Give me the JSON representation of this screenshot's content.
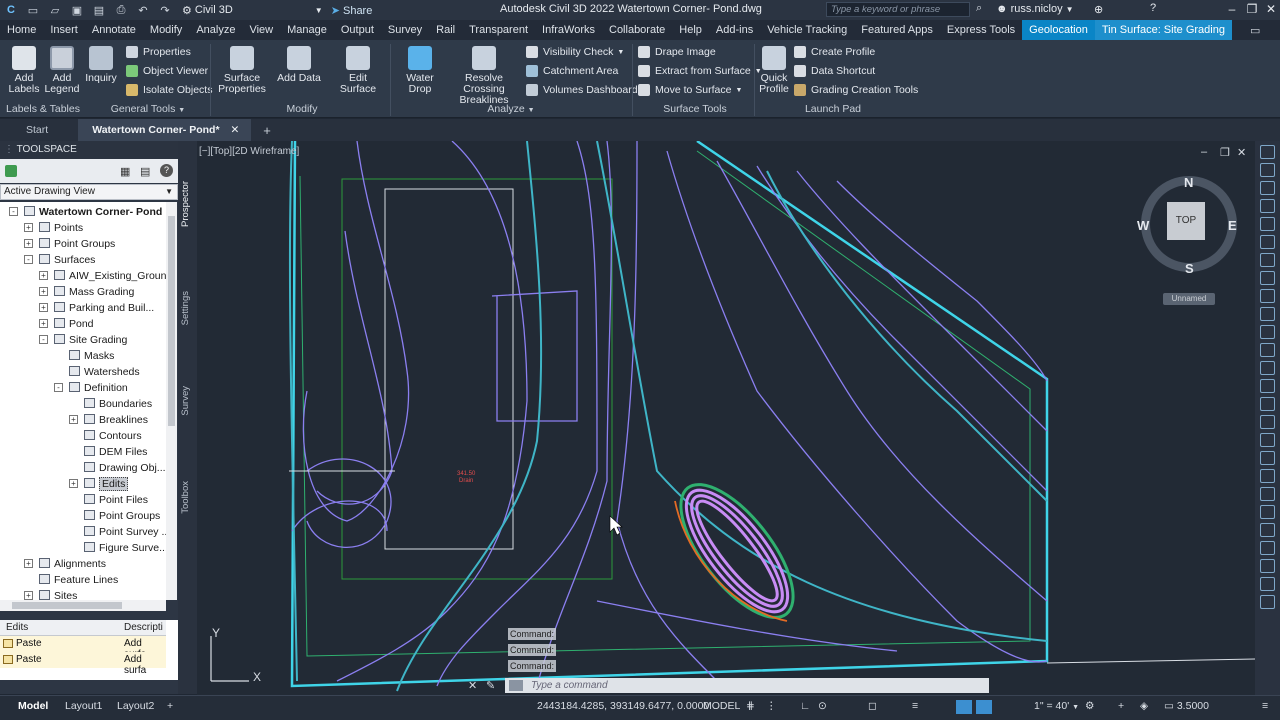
{
  "titlebar": {
    "workspace": "Civil 3D",
    "share": "Share",
    "title": "Autodesk Civil 3D 2022    Watertown Corner- Pond.dwg",
    "search_placeholder": "Type a keyword or phrase",
    "user": "russ.nicloy"
  },
  "ribbon_tabs": [
    "Home",
    "Insert",
    "Annotate",
    "Modify",
    "Analyze",
    "View",
    "Manage",
    "Output",
    "Survey",
    "Rail",
    "Transparent",
    "InfraWorks",
    "Collaborate",
    "Help",
    "Add-ins",
    "Vehicle Tracking",
    "Featured Apps",
    "Express Tools",
    "Geolocation",
    "Tin Surface: Site Grading"
  ],
  "ribbon": {
    "add_labels": "Add Labels",
    "add_legend": "Add Legend",
    "inquiry": "Inquiry",
    "properties": "Properties",
    "object_viewer": "Object Viewer",
    "isolate_objects": "Isolate Objects",
    "surface_properties": "Surface Properties",
    "add_data": "Add Data",
    "edit_surface": "Edit Surface",
    "water_drop": "Water Drop",
    "resolve_crossing": "Resolve Crossing Breaklines",
    "visibility_check": "Visibility Check",
    "catchment_area": "Catchment Area",
    "volumes_dashboard": "Volumes Dashboard",
    "drape_image": "Drape Image",
    "extract_from_surface": "Extract from Surface",
    "move_to_surface": "Move to Surface",
    "quick_profile": "Quick Profile",
    "create_profile": "Create Profile",
    "data_shortcut": "Data Shortcut",
    "grading_creation_tools": "Grading Creation Tools",
    "panels": {
      "labels_tables": "Labels & Tables",
      "general_tools": "General Tools",
      "modify": "Modify",
      "analyze": "Analyze",
      "surface_tools": "Surface Tools",
      "launch_pad": "Launch Pad"
    }
  },
  "doc_tabs": [
    "Start",
    "Watertown Corner- Pond*"
  ],
  "toolspace": {
    "title": "TOOLSPACE",
    "view_select": "Active Drawing View",
    "side_tabs": [
      "Prospector",
      "Settings",
      "Survey",
      "Toolbox"
    ],
    "tree": [
      {
        "label": "Watertown Corner- Pond",
        "level": 0,
        "bold": true
      },
      {
        "label": "Points",
        "level": 1
      },
      {
        "label": "Point Groups",
        "level": 1
      },
      {
        "label": "Surfaces",
        "level": 1
      },
      {
        "label": "AIW_Existing_Ground",
        "level": 2
      },
      {
        "label": "Mass Grading",
        "level": 2
      },
      {
        "label": "Parking and Buil...",
        "level": 2
      },
      {
        "label": "Pond",
        "level": 2
      },
      {
        "label": "Site Grading",
        "level": 2
      },
      {
        "label": "Masks",
        "level": 3
      },
      {
        "label": "Watersheds",
        "level": 3
      },
      {
        "label": "Definition",
        "level": 3
      },
      {
        "label": "Boundaries",
        "level": 4
      },
      {
        "label": "Breaklines",
        "level": 4
      },
      {
        "label": "Contours",
        "level": 4
      },
      {
        "label": "DEM Files",
        "level": 4
      },
      {
        "label": "Drawing Obj...",
        "level": 4
      },
      {
        "label": "Edits",
        "level": 4,
        "selected": true
      },
      {
        "label": "Point Files",
        "level": 4
      },
      {
        "label": "Point Groups",
        "level": 4
      },
      {
        "label": "Point Survey ...",
        "level": 4
      },
      {
        "label": "Figure Surve...",
        "level": 4
      },
      {
        "label": "Alignments",
        "level": 1
      },
      {
        "label": "Feature Lines",
        "level": 1
      },
      {
        "label": "Sites",
        "level": 1
      }
    ],
    "list_headers": [
      "Edits",
      "Descripti"
    ],
    "list_rows": [
      [
        "Paste",
        "Add surfa"
      ],
      [
        "Paste",
        "Add surfa"
      ]
    ]
  },
  "viewport": {
    "label": "[−][Top][2D Wireframe]",
    "compass": {
      "n": "N",
      "s": "S",
      "e": "E",
      "w": "W",
      "top": "TOP"
    },
    "ucs_name": "Unnamed",
    "point_label": "341.50",
    "point_desc": "Drain"
  },
  "command": {
    "history": [
      "Command:",
      "Command:",
      "Command:"
    ],
    "placeholder": "Type a command"
  },
  "statusbar": {
    "tabs": [
      "Model",
      "Layout1",
      "Layout2"
    ],
    "coords": "2443184.4285, 393149.6477, 0.0000",
    "model": "MODEL",
    "scale": "1\" = 40'",
    "value": "3.5000"
  }
}
